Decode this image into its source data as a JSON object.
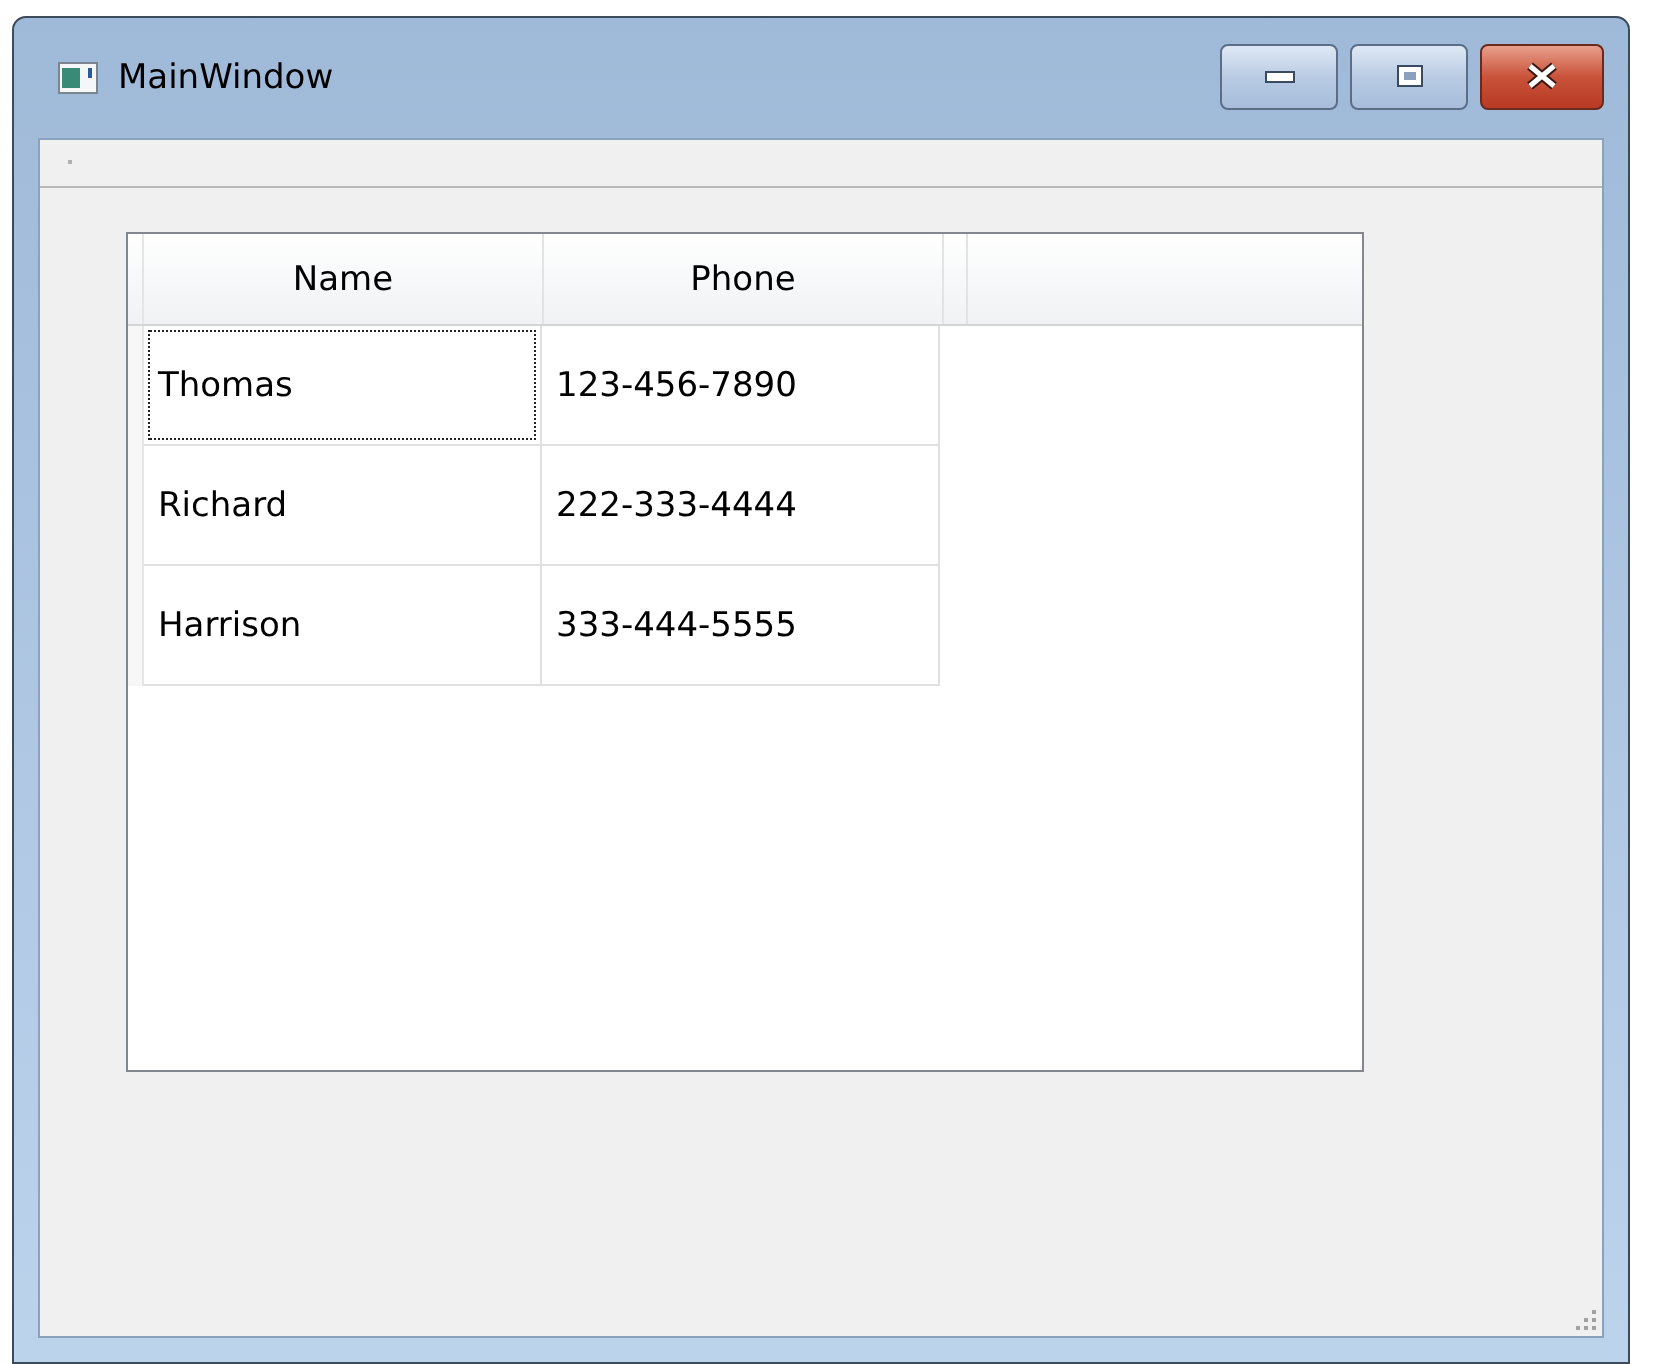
{
  "window": {
    "title": "MainWindow"
  },
  "table": {
    "columns": [
      "Name",
      "Phone"
    ],
    "rows": [
      {
        "name": "Thomas",
        "phone": "123-456-7890",
        "focused": true
      },
      {
        "name": "Richard",
        "phone": "222-333-4444",
        "focused": false
      },
      {
        "name": "Harrison",
        "phone": "333-444-5555",
        "focused": false
      }
    ]
  }
}
